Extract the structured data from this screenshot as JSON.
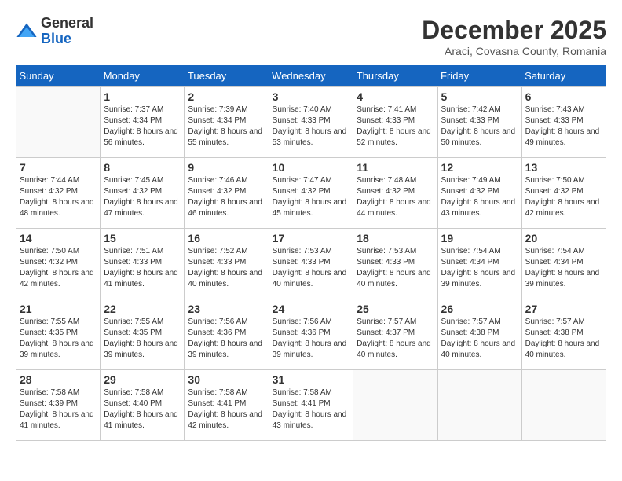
{
  "logo": {
    "general": "General",
    "blue": "Blue"
  },
  "title": {
    "month": "December 2025",
    "location": "Araci, Covasna County, Romania"
  },
  "days_header": [
    "Sunday",
    "Monday",
    "Tuesday",
    "Wednesday",
    "Thursday",
    "Friday",
    "Saturday"
  ],
  "weeks": [
    [
      {
        "day": "",
        "sunrise": "",
        "sunset": "",
        "daylight": ""
      },
      {
        "day": "1",
        "sunrise": "Sunrise: 7:37 AM",
        "sunset": "Sunset: 4:34 PM",
        "daylight": "Daylight: 8 hours and 56 minutes."
      },
      {
        "day": "2",
        "sunrise": "Sunrise: 7:39 AM",
        "sunset": "Sunset: 4:34 PM",
        "daylight": "Daylight: 8 hours and 55 minutes."
      },
      {
        "day": "3",
        "sunrise": "Sunrise: 7:40 AM",
        "sunset": "Sunset: 4:33 PM",
        "daylight": "Daylight: 8 hours and 53 minutes."
      },
      {
        "day": "4",
        "sunrise": "Sunrise: 7:41 AM",
        "sunset": "Sunset: 4:33 PM",
        "daylight": "Daylight: 8 hours and 52 minutes."
      },
      {
        "day": "5",
        "sunrise": "Sunrise: 7:42 AM",
        "sunset": "Sunset: 4:33 PM",
        "daylight": "Daylight: 8 hours and 50 minutes."
      },
      {
        "day": "6",
        "sunrise": "Sunrise: 7:43 AM",
        "sunset": "Sunset: 4:33 PM",
        "daylight": "Daylight: 8 hours and 49 minutes."
      }
    ],
    [
      {
        "day": "7",
        "sunrise": "Sunrise: 7:44 AM",
        "sunset": "Sunset: 4:32 PM",
        "daylight": "Daylight: 8 hours and 48 minutes."
      },
      {
        "day": "8",
        "sunrise": "Sunrise: 7:45 AM",
        "sunset": "Sunset: 4:32 PM",
        "daylight": "Daylight: 8 hours and 47 minutes."
      },
      {
        "day": "9",
        "sunrise": "Sunrise: 7:46 AM",
        "sunset": "Sunset: 4:32 PM",
        "daylight": "Daylight: 8 hours and 46 minutes."
      },
      {
        "day": "10",
        "sunrise": "Sunrise: 7:47 AM",
        "sunset": "Sunset: 4:32 PM",
        "daylight": "Daylight: 8 hours and 45 minutes."
      },
      {
        "day": "11",
        "sunrise": "Sunrise: 7:48 AM",
        "sunset": "Sunset: 4:32 PM",
        "daylight": "Daylight: 8 hours and 44 minutes."
      },
      {
        "day": "12",
        "sunrise": "Sunrise: 7:49 AM",
        "sunset": "Sunset: 4:32 PM",
        "daylight": "Daylight: 8 hours and 43 minutes."
      },
      {
        "day": "13",
        "sunrise": "Sunrise: 7:50 AM",
        "sunset": "Sunset: 4:32 PM",
        "daylight": "Daylight: 8 hours and 42 minutes."
      }
    ],
    [
      {
        "day": "14",
        "sunrise": "Sunrise: 7:50 AM",
        "sunset": "Sunset: 4:32 PM",
        "daylight": "Daylight: 8 hours and 42 minutes."
      },
      {
        "day": "15",
        "sunrise": "Sunrise: 7:51 AM",
        "sunset": "Sunset: 4:33 PM",
        "daylight": "Daylight: 8 hours and 41 minutes."
      },
      {
        "day": "16",
        "sunrise": "Sunrise: 7:52 AM",
        "sunset": "Sunset: 4:33 PM",
        "daylight": "Daylight: 8 hours and 40 minutes."
      },
      {
        "day": "17",
        "sunrise": "Sunrise: 7:53 AM",
        "sunset": "Sunset: 4:33 PM",
        "daylight": "Daylight: 8 hours and 40 minutes."
      },
      {
        "day": "18",
        "sunrise": "Sunrise: 7:53 AM",
        "sunset": "Sunset: 4:33 PM",
        "daylight": "Daylight: 8 hours and 40 minutes."
      },
      {
        "day": "19",
        "sunrise": "Sunrise: 7:54 AM",
        "sunset": "Sunset: 4:34 PM",
        "daylight": "Daylight: 8 hours and 39 minutes."
      },
      {
        "day": "20",
        "sunrise": "Sunrise: 7:54 AM",
        "sunset": "Sunset: 4:34 PM",
        "daylight": "Daylight: 8 hours and 39 minutes."
      }
    ],
    [
      {
        "day": "21",
        "sunrise": "Sunrise: 7:55 AM",
        "sunset": "Sunset: 4:35 PM",
        "daylight": "Daylight: 8 hours and 39 minutes."
      },
      {
        "day": "22",
        "sunrise": "Sunrise: 7:55 AM",
        "sunset": "Sunset: 4:35 PM",
        "daylight": "Daylight: 8 hours and 39 minutes."
      },
      {
        "day": "23",
        "sunrise": "Sunrise: 7:56 AM",
        "sunset": "Sunset: 4:36 PM",
        "daylight": "Daylight: 8 hours and 39 minutes."
      },
      {
        "day": "24",
        "sunrise": "Sunrise: 7:56 AM",
        "sunset": "Sunset: 4:36 PM",
        "daylight": "Daylight: 8 hours and 39 minutes."
      },
      {
        "day": "25",
        "sunrise": "Sunrise: 7:57 AM",
        "sunset": "Sunset: 4:37 PM",
        "daylight": "Daylight: 8 hours and 40 minutes."
      },
      {
        "day": "26",
        "sunrise": "Sunrise: 7:57 AM",
        "sunset": "Sunset: 4:38 PM",
        "daylight": "Daylight: 8 hours and 40 minutes."
      },
      {
        "day": "27",
        "sunrise": "Sunrise: 7:57 AM",
        "sunset": "Sunset: 4:38 PM",
        "daylight": "Daylight: 8 hours and 40 minutes."
      }
    ],
    [
      {
        "day": "28",
        "sunrise": "Sunrise: 7:58 AM",
        "sunset": "Sunset: 4:39 PM",
        "daylight": "Daylight: 8 hours and 41 minutes."
      },
      {
        "day": "29",
        "sunrise": "Sunrise: 7:58 AM",
        "sunset": "Sunset: 4:40 PM",
        "daylight": "Daylight: 8 hours and 41 minutes."
      },
      {
        "day": "30",
        "sunrise": "Sunrise: 7:58 AM",
        "sunset": "Sunset: 4:41 PM",
        "daylight": "Daylight: 8 hours and 42 minutes."
      },
      {
        "day": "31",
        "sunrise": "Sunrise: 7:58 AM",
        "sunset": "Sunset: 4:41 PM",
        "daylight": "Daylight: 8 hours and 43 minutes."
      },
      {
        "day": "",
        "sunrise": "",
        "sunset": "",
        "daylight": ""
      },
      {
        "day": "",
        "sunrise": "",
        "sunset": "",
        "daylight": ""
      },
      {
        "day": "",
        "sunrise": "",
        "sunset": "",
        "daylight": ""
      }
    ]
  ]
}
